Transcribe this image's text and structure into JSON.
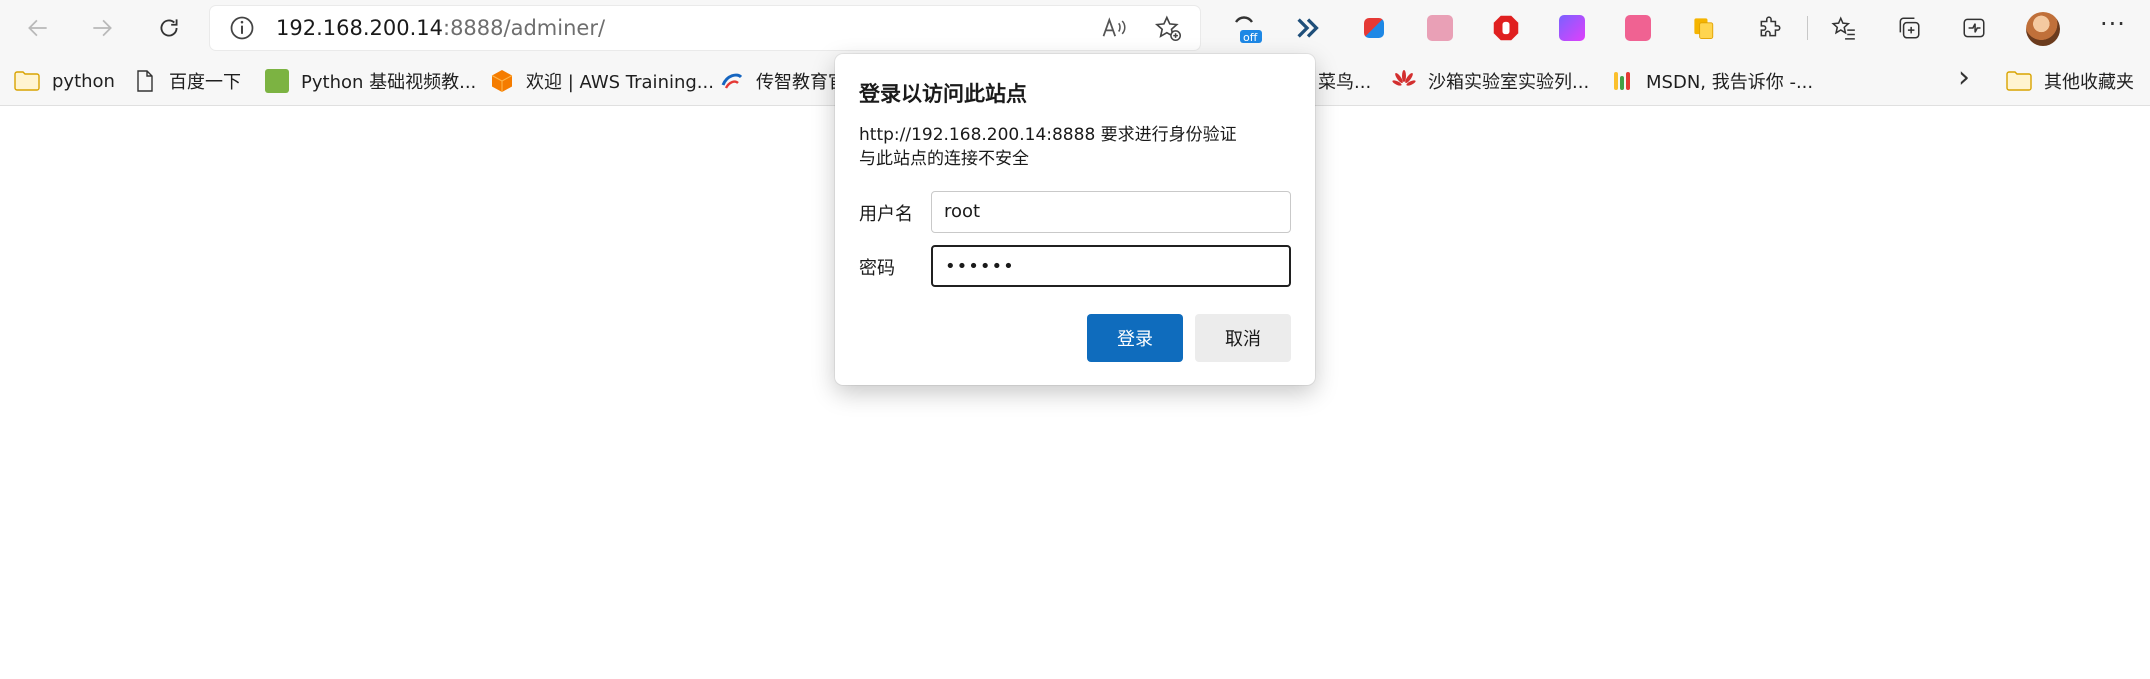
{
  "browser": {
    "address": {
      "host": "192.168.200.14",
      "rest": ":8888/adminer/"
    },
    "off_badge": "off",
    "menu_glyph": "···",
    "icons": {
      "back": "back-arrow-icon",
      "forward": "forward-arrow-icon",
      "refresh": "refresh-icon",
      "info": "info-icon",
      "read_aloud": "read-aloud-icon",
      "favorite_add": "add-favorite-icon",
      "extensions": "puzzle-icon",
      "favorites": "favorites-icon",
      "collections": "collections-icon",
      "performance": "performance-icon"
    },
    "accent_color": "#0f6cbd"
  },
  "bookmarks": {
    "items": [
      {
        "label": "python",
        "icon": "folder-icon"
      },
      {
        "label": "百度一下",
        "icon": "page-icon"
      },
      {
        "label": "Python 基础视频教...",
        "icon": "green-logo-icon"
      },
      {
        "label": "欢迎 | AWS Training...",
        "icon": "aws-cube-icon"
      },
      {
        "label": "传智教育官",
        "icon": "itcast-logo-icon"
      },
      {
        "label": "菜鸟...",
        "icon": ""
      },
      {
        "label": "沙箱实验室实验列...",
        "icon": "huawei-logo-icon"
      },
      {
        "label": "MSDN, 我告诉你 -...",
        "icon": "msdn-logo-icon"
      }
    ],
    "overflow_glyph": "›",
    "other_folder": "其他收藏夹"
  },
  "dialog": {
    "title": "登录以访问此站点",
    "message_line1": "http://192.168.200.14:8888 要求进行身份验证",
    "message_line2": "与此站点的连接不安全",
    "username_label": "用户名",
    "username_value": "root",
    "password_label": "密码",
    "password_value": "••••••",
    "login_button": "登录",
    "cancel_button": "取消"
  }
}
